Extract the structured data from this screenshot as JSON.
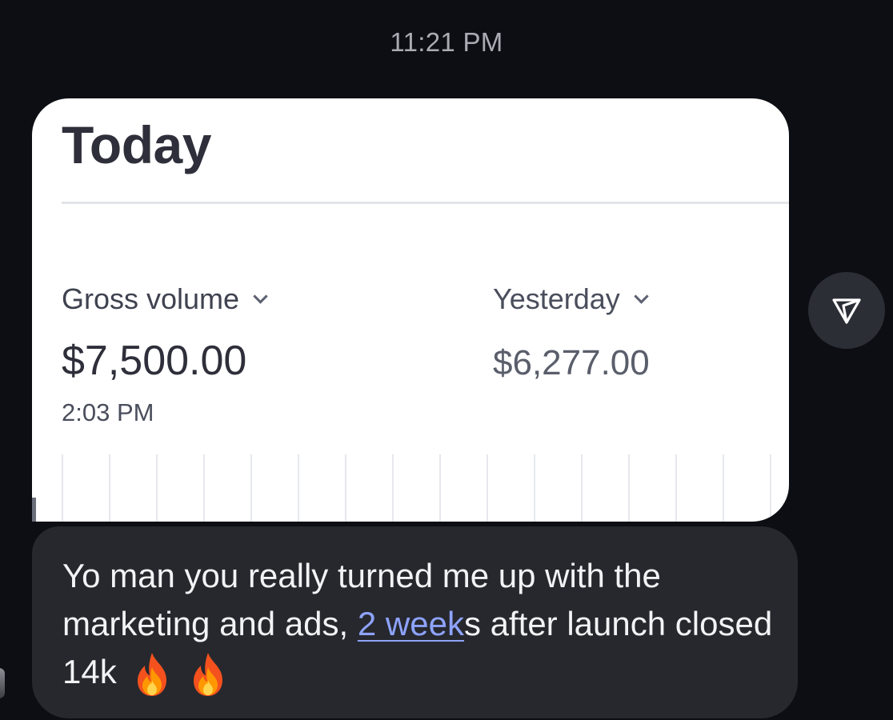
{
  "header": {
    "timestamp": "11:21 PM"
  },
  "card": {
    "title": "Today",
    "gross_volume": {
      "label": "Gross volume",
      "value": "$7,500.00",
      "time": "2:03 PM"
    },
    "yesterday": {
      "label": "Yesterday",
      "value": "$6,277.00"
    }
  },
  "share": {
    "icon": "send-icon"
  },
  "message": {
    "text_before": "Yo man you really turned me up with the marketing and ads, ",
    "link_text": "2 week",
    "text_after": "s after launch closed 14k",
    "emojis": [
      "fire",
      "fire"
    ]
  },
  "colors": {
    "background": "#0c0e13",
    "bubble": "#26282e",
    "link": "#8ea3ff",
    "card": "#ffffff"
  }
}
